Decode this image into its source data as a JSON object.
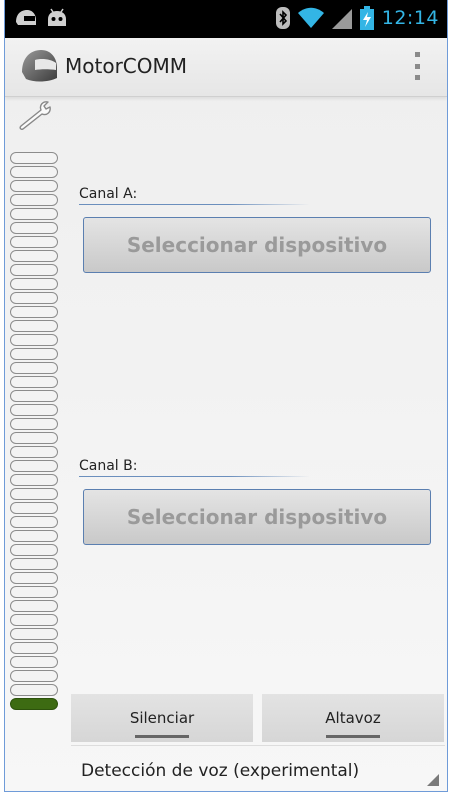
{
  "status_bar": {
    "time": "12:14",
    "icons": [
      "helmet-notification-icon",
      "android-notification-icon",
      "bluetooth-icon",
      "wifi-icon",
      "signal-icon",
      "battery-charging-icon"
    ]
  },
  "action_bar": {
    "title": "MotorCOMM",
    "app_icon": "helmet-icon",
    "overflow_icon": "overflow-menu-icon"
  },
  "settings_icon": "wrench-icon",
  "level_meter": {
    "segments_total": 40,
    "segments_active": 1,
    "active_color": "#3d6b12"
  },
  "channel_a": {
    "label": "Canal A:",
    "button": "Seleccionar dispositivo"
  },
  "channel_b": {
    "label": "Canal B:",
    "button": "Seleccionar dispositivo"
  },
  "bottom": {
    "mute_button": "Silenciar",
    "speaker_button": "Altavoz",
    "voice_detection": "Detección de voz (experimental)"
  },
  "colors": {
    "accent": "#33b5e5",
    "button_border": "#5b7fb0"
  }
}
